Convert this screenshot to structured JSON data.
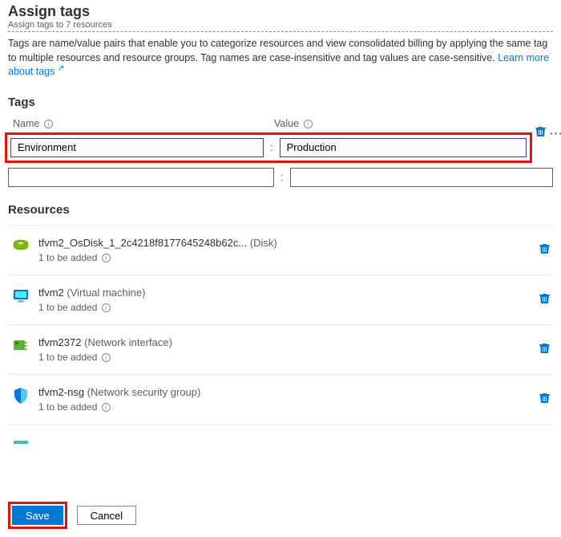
{
  "header": {
    "title": "Assign tags",
    "subtitle": "Assign tags to 7 resources",
    "description_a": "Tags are name/value pairs that enable you to categorize resources and view consolidated billing by applying the same tag to multiple resources and resource groups. Tag names are case-insensitive and tag values are case-sensitive. ",
    "learn_more": "Learn more about tags"
  },
  "tags": {
    "section_label": "Tags",
    "name_label": "Name",
    "value_label": "Value",
    "row1": {
      "name": "Environment",
      "value": "Production"
    },
    "row2": {
      "name": "",
      "value": ""
    }
  },
  "resources": {
    "section_label": "Resources",
    "added_text": "1 to be added",
    "items": [
      {
        "name": "tfvm2_OsDisk_1_2c4218f8177645248b62c...",
        "type": "(Disk)",
        "icon": "disk"
      },
      {
        "name": "tfvm2",
        "type": "(Virtual machine)",
        "icon": "vm"
      },
      {
        "name": "tfvm2372",
        "type": "(Network interface)",
        "icon": "nic"
      },
      {
        "name": "tfvm2-nsg",
        "type": "(Network security group)",
        "icon": "nsg"
      }
    ]
  },
  "footer": {
    "save": "Save",
    "cancel": "Cancel"
  }
}
